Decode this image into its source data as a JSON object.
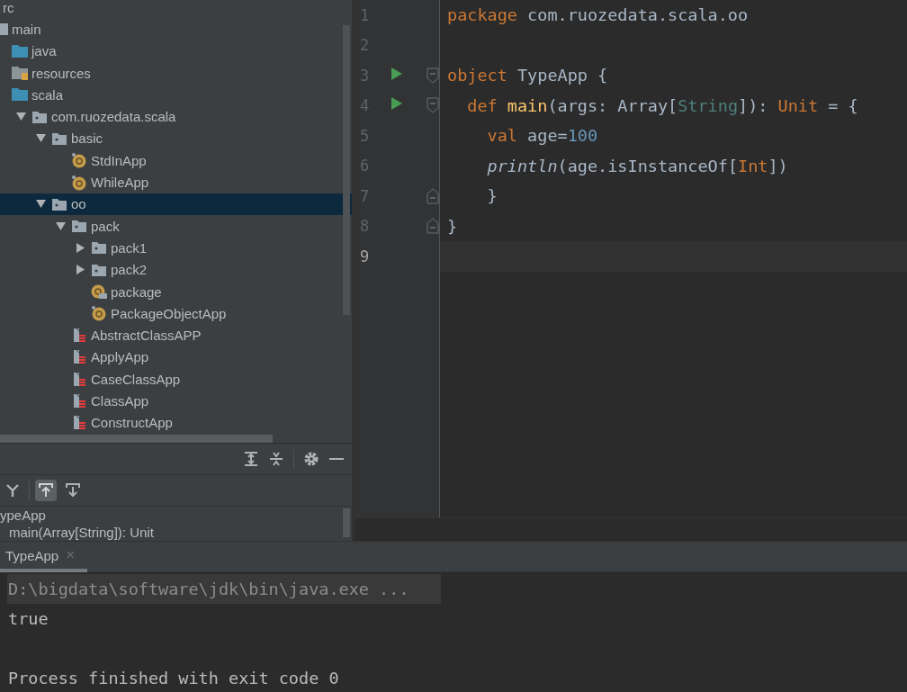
{
  "project_tree": [
    {
      "label": "rc",
      "selected": false,
      "children": [
        {
          "label": "main",
          "kind": "folder",
          "selected": false,
          "children": [
            {
              "label": "java",
              "kind": "source-folder",
              "selected": false
            },
            {
              "label": "resources",
              "kind": "resources-folder",
              "selected": false
            },
            {
              "label": "scala",
              "kind": "source-folder",
              "selected": false,
              "children": [
                {
                  "label": "com.ruozedata.scala",
                  "kind": "package",
                  "expanded": true,
                  "selected": false,
                  "children": [
                    {
                      "label": "basic",
                      "kind": "package",
                      "expanded": true,
                      "selected": false,
                      "children": [
                        {
                          "label": "StdInApp",
                          "kind": "object",
                          "selected": false
                        },
                        {
                          "label": "WhileApp",
                          "kind": "object",
                          "selected": false
                        }
                      ]
                    },
                    {
                      "label": "oo",
                      "kind": "package",
                      "expanded": true,
                      "selected": true,
                      "children": [
                        {
                          "label": "pack",
                          "kind": "package",
                          "expanded": true,
                          "selected": false,
                          "children": [
                            {
                              "label": "pack1",
                              "kind": "package",
                              "expanded": false,
                              "selected": false
                            },
                            {
                              "label": "pack2",
                              "kind": "package",
                              "expanded": false,
                              "selected": false
                            },
                            {
                              "label": "package",
                              "kind": "package-object",
                              "selected": false
                            },
                            {
                              "label": "PackageObjectApp",
                              "kind": "object",
                              "selected": false
                            }
                          ]
                        },
                        {
                          "label": "AbstractClassAPP",
                          "kind": "class",
                          "selected": false
                        },
                        {
                          "label": "ApplyApp",
                          "kind": "class",
                          "selected": false
                        },
                        {
                          "label": "CaseClassApp",
                          "kind": "class",
                          "selected": false
                        },
                        {
                          "label": "ClassApp",
                          "kind": "class",
                          "selected": false
                        },
                        {
                          "label": "ConstructApp",
                          "kind": "class",
                          "selected": false
                        }
                      ]
                    }
                  ]
                }
              ]
            }
          ]
        }
      ]
    }
  ],
  "structure": {
    "toolbar": [
      {
        "kind": "expand-all"
      },
      {
        "kind": "collapse-all"
      },
      {
        "kind": "separator"
      },
      {
        "kind": "settings"
      },
      {
        "kind": "hide"
      }
    ],
    "view_options": [
      {
        "kind": "sort",
        "selected": false
      },
      {
        "kind": "separator"
      },
      {
        "kind": "scroll-from-source",
        "selected": true
      },
      {
        "kind": "scroll-to-source",
        "selected": false
      }
    ],
    "items": [
      {
        "label": "ypeApp",
        "children": [
          {
            "label": "main(Array[String]): Unit"
          }
        ]
      }
    ]
  },
  "editor": {
    "lines": [
      {
        "number": "1",
        "current": false,
        "tokens": [
          {
            "kind": "keyword",
            "text": "package "
          },
          {
            "kind": "text",
            "text": "com.ruozedata.scala.oo"
          }
        ]
      },
      {
        "number": "2",
        "current": false
      },
      {
        "number": "3",
        "current": false,
        "run": true,
        "fold": {
          "kind": "start"
        },
        "tokens": [
          {
            "kind": "keyword",
            "text": "object "
          },
          {
            "kind": "text",
            "text": "TypeApp {"
          }
        ]
      },
      {
        "number": "4",
        "current": false,
        "run": true,
        "fold": {
          "kind": "start"
        },
        "tokens": [
          {
            "kind": "keyword",
            "text": "  def "
          },
          {
            "kind": "method",
            "text": "main"
          },
          {
            "kind": "text",
            "text": "(args: Array["
          },
          {
            "kind": "type-param",
            "text": "String"
          },
          {
            "kind": "text",
            "text": "]): "
          },
          {
            "kind": "type",
            "text": "Unit"
          },
          {
            "kind": "text",
            "text": " = {"
          }
        ]
      },
      {
        "number": "5",
        "current": false,
        "tokens": [
          {
            "kind": "keyword",
            "text": "    val "
          },
          {
            "kind": "text",
            "text": "age="
          },
          {
            "kind": "number",
            "text": "100"
          }
        ]
      },
      {
        "number": "6",
        "current": false,
        "tokens": [
          {
            "kind": "call",
            "text": "    println"
          },
          {
            "kind": "text",
            "text": "(age.isInstanceOf["
          },
          {
            "kind": "type",
            "text": "Int"
          },
          {
            "kind": "text",
            "text": "])"
          }
        ]
      },
      {
        "number": "7",
        "current": false,
        "fold": {
          "kind": "end"
        },
        "tokens": [
          {
            "kind": "text",
            "text": "    }"
          }
        ]
      },
      {
        "number": "8",
        "current": false,
        "fold": {
          "kind": "end"
        },
        "tokens": [
          {
            "kind": "text",
            "text": "}"
          }
        ]
      },
      {
        "number": "9",
        "current": true
      }
    ]
  },
  "run_panel": {
    "tabs": [
      {
        "label": "TypeApp",
        "close": "×",
        "selected": true
      }
    ],
    "console": [
      {
        "kind": "command",
        "text": "D:\\bigdata\\software\\jdk\\bin\\java.exe ..."
      },
      {
        "kind": "output",
        "text": "true"
      },
      {
        "kind": "blank"
      },
      {
        "kind": "output",
        "text": "Process finished with exit code 0"
      }
    ]
  }
}
